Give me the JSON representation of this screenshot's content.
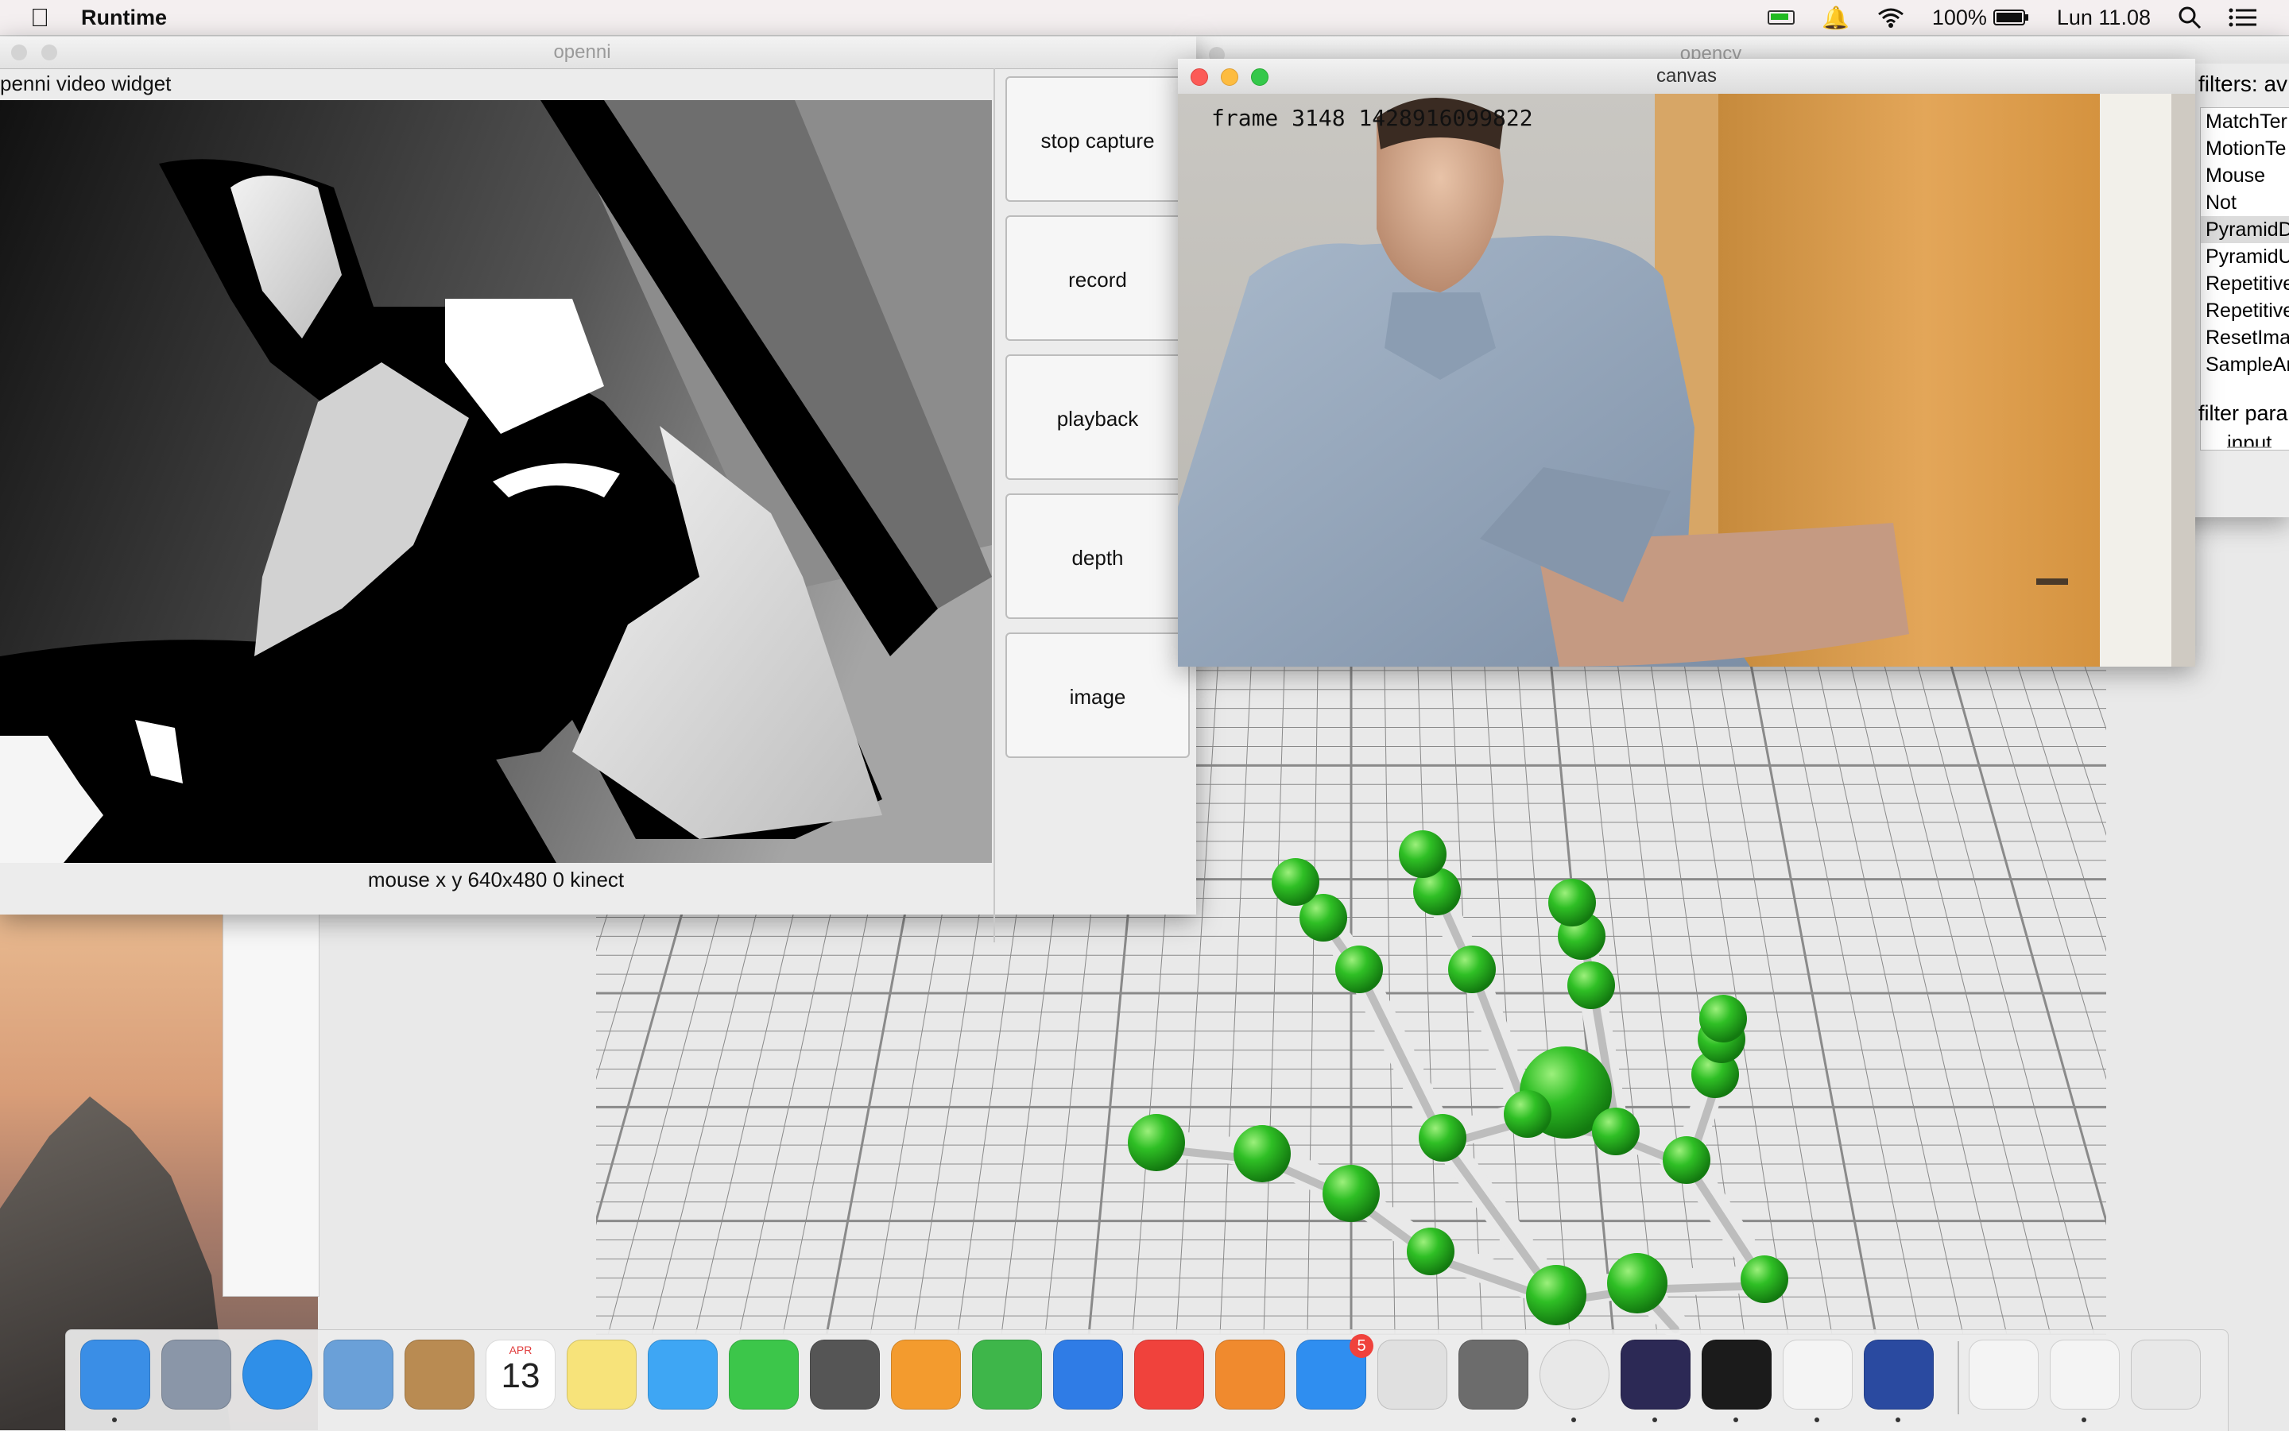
{
  "menubar": {
    "app_name": "Runtime",
    "battery": "100%",
    "clock": "Lun 11.08"
  },
  "openni_window": {
    "title": "openni",
    "widget_label": "penni  video widget",
    "status": "mouse x y 640x480 0 kinect",
    "buttons": [
      "stop capture",
      "record",
      "playback",
      "depth",
      "image"
    ]
  },
  "opencv_window": {
    "title": "opencv",
    "filters_label": "filters: av",
    "filters": [
      "MatchTer",
      "MotionTe",
      "Mouse",
      "Not",
      "PyramidD",
      "PyramidU",
      "Repetitive",
      "Repetitive",
      "ResetIma",
      "SampleAr"
    ],
    "selected_filter": "PyramidD",
    "params_label": "filter para",
    "input_label": "input"
  },
  "canvas_window": {
    "title": "canvas",
    "frame_text": "frame 3148 1428916099822"
  },
  "dock": {
    "badge_appstore": "5",
    "calendar_month": "APR",
    "calendar_day": "13"
  }
}
